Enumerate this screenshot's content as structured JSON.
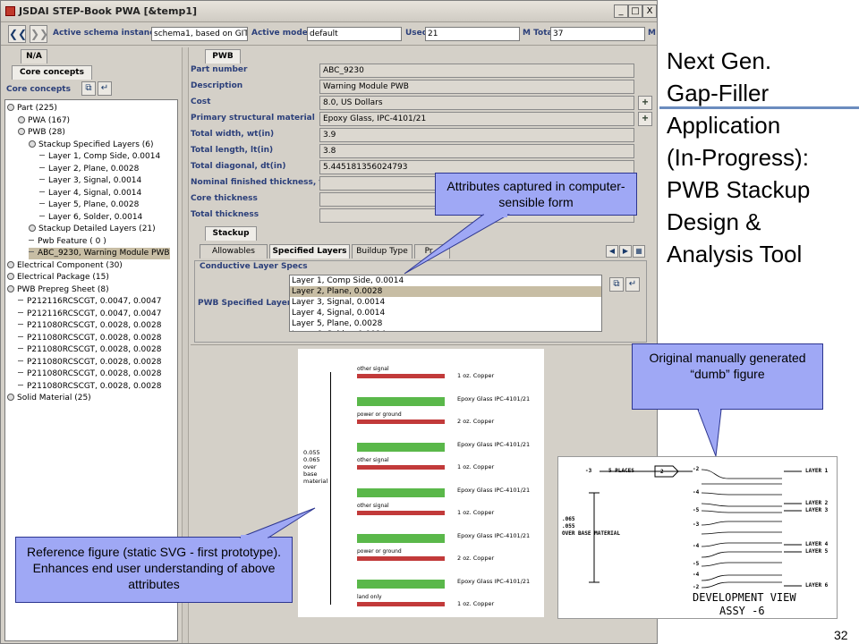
{
  "window": {
    "title": "JSDAI STEP-Book PWA [&temp1]",
    "buttons": {
      "minimize": "_",
      "maximize": "□",
      "close": "X"
    }
  },
  "toolbar": {
    "schema_label": "Active schema instance:",
    "schema_value": "schema1, based on GIT",
    "model_label": "Active model:",
    "model_value": "default",
    "used_label": "Used",
    "used_value": "21",
    "mtotal_label": "M Total",
    "mtotal_value": "37",
    "end_label": "M"
  },
  "left_panel": {
    "tab_label": "N/A",
    "subtab_label": "Core concepts",
    "title": "Core concepts",
    "tree": [
      {
        "label": "Part (225)",
        "level": 0,
        "type": "node"
      },
      {
        "label": "PWA (167)",
        "level": 1,
        "type": "node"
      },
      {
        "label": "PWB (28)",
        "level": 1,
        "type": "node"
      },
      {
        "label": "Stackup Specified Layers (6)",
        "level": 2,
        "type": "node"
      },
      {
        "label": "Layer 1, Comp Side, 0.0014",
        "level": 3,
        "type": "leaf"
      },
      {
        "label": "Layer 2, Plane, 0.0028",
        "level": 3,
        "type": "leaf"
      },
      {
        "label": "Layer 3, Signal, 0.0014",
        "level": 3,
        "type": "leaf"
      },
      {
        "label": "Layer 4, Signal, 0.0014",
        "level": 3,
        "type": "leaf"
      },
      {
        "label": "Layer 5, Plane, 0.0028",
        "level": 3,
        "type": "leaf"
      },
      {
        "label": "Layer 6, Solder, 0.0014",
        "level": 3,
        "type": "leaf"
      },
      {
        "label": "Stackup Detailed Layers (21)",
        "level": 2,
        "type": "node"
      },
      {
        "label": "Pwb Feature ( 0 )",
        "level": 2,
        "type": "leaf"
      },
      {
        "label": "ABC_9230, Warning Module PWB",
        "level": 2,
        "type": "leaf",
        "selected": true
      },
      {
        "label": "Electrical Component (30)",
        "level": 0,
        "type": "node"
      },
      {
        "label": "Electrical Package (15)",
        "level": 0,
        "type": "node"
      },
      {
        "label": "PWB Prepreg Sheet (8)",
        "level": 0,
        "type": "node"
      },
      {
        "label": "P212116RCSCGT, 0.0047, 0.0047",
        "level": 1,
        "type": "leaf"
      },
      {
        "label": "P212116RCSCGT, 0.0047, 0.0047",
        "level": 1,
        "type": "leaf"
      },
      {
        "label": "P211080RCSCGT, 0.0028, 0.0028",
        "level": 1,
        "type": "leaf"
      },
      {
        "label": "P211080RCSCGT, 0.0028, 0.0028",
        "level": 1,
        "type": "leaf"
      },
      {
        "label": "P211080RCSCGT, 0.0028, 0.0028",
        "level": 1,
        "type": "leaf"
      },
      {
        "label": "P211080RCSCGT, 0.0028, 0.0028",
        "level": 1,
        "type": "leaf"
      },
      {
        "label": "P211080RCSCGT, 0.0028, 0.0028",
        "level": 1,
        "type": "leaf"
      },
      {
        "label": "P211080RCSCGT, 0.0028, 0.0028",
        "level": 1,
        "type": "leaf"
      },
      {
        "label": "Solid Material (25)",
        "level": 0,
        "type": "node"
      }
    ]
  },
  "right_panel": {
    "tab_label": "PWB",
    "properties": [
      {
        "label": "Part number",
        "value": "ABC_9230",
        "plus": false
      },
      {
        "label": "Description",
        "value": "Warning Module PWB",
        "plus": false
      },
      {
        "label": "Cost",
        "value": "8.0, US Dollars",
        "plus": true
      },
      {
        "label": "Primary structural material",
        "value": "Epoxy Glass, IPC-4101/21",
        "plus": true
      },
      {
        "label": "Total width, wt(in)",
        "value": "3.9",
        "plus": false
      },
      {
        "label": "Total length, lt(in)",
        "value": "3.8",
        "plus": false
      },
      {
        "label": "Total diagonal, dt(in)",
        "value": "5.445181356024793",
        "plus": false
      },
      {
        "label": "Nominal finished thickness, t(in)",
        "value": "",
        "plus": false
      },
      {
        "label": "Core thickness",
        "value": "",
        "plus": false
      },
      {
        "label": "Total thickness",
        "value": "",
        "plus": false
      }
    ],
    "stackup_tab": "Stackup",
    "subtabs": [
      "Allowables",
      "Specified Layers",
      "Buildup Type",
      "Pr..."
    ],
    "group_title": "Conductive Layer Specs",
    "list_label": "PWB Specified Layers",
    "list_items": [
      {
        "label": "Layer 1, Comp Side, 0.0014"
      },
      {
        "label": "Layer 2, Plane, 0.0028",
        "selected": true
      },
      {
        "label": "Layer 3, Signal, 0.0014"
      },
      {
        "label": "Layer 4, Signal, 0.0014"
      },
      {
        "label": "Layer 5, Plane, 0.0028"
      },
      {
        "label": "Layer 6, Solder, 0.0014"
      }
    ]
  },
  "reference_figure": {
    "dimension_text": [
      "0.055",
      "0.065",
      "over",
      "base",
      "material"
    ],
    "layers": [
      {
        "name": "other signal",
        "material": "1 oz. Copper",
        "kind": "copper"
      },
      {
        "name": "",
        "material": "Epoxy Glass IPC-4101/21",
        "kind": "epoxy"
      },
      {
        "name": "power or ground",
        "material": "2 oz. Copper",
        "kind": "copper"
      },
      {
        "name": "",
        "material": "Epoxy Glass IPC-4101/21",
        "kind": "epoxy"
      },
      {
        "name": "other signal",
        "material": "1 oz. Copper",
        "kind": "copper"
      },
      {
        "name": "",
        "material": "Epoxy Glass IPC-4101/21",
        "kind": "epoxy"
      },
      {
        "name": "other signal",
        "material": "1 oz. Copper",
        "kind": "copper"
      },
      {
        "name": "",
        "material": "Epoxy Glass IPC-4101/21",
        "kind": "epoxy"
      },
      {
        "name": "power or ground",
        "material": "2 oz. Copper",
        "kind": "copper"
      },
      {
        "name": "",
        "material": "Epoxy Glass IPC-4101/21",
        "kind": "epoxy"
      },
      {
        "name": "land only",
        "material": "1 oz. Copper",
        "kind": "copper"
      }
    ],
    "colors": {
      "copper": "#c23a3a",
      "epoxy": "#5ab84a"
    }
  },
  "development_figure": {
    "places_label": "5 PLACES",
    "places_box": "2",
    "dimension_label": ".065\n.055\nOVER BASE MATERIAL",
    "layer_labels": [
      "LAYER 1",
      "LAYER 2",
      "LAYER 3",
      "LAYER 4",
      "LAYER 5",
      "LAYER 6"
    ],
    "tick_labels": [
      "-2",
      "-3",
      "-4",
      "-5",
      "-3",
      "-4",
      "-5",
      "-4",
      "-2"
    ],
    "caption_line1": "DEVELOPMENT VIEW",
    "caption_line2": "ASSY -6"
  },
  "slide": {
    "title_lines": [
      "Next Gen.",
      "Gap-Filler",
      "Application",
      "(In-Progress):",
      "PWB Stackup",
      "Design &",
      "Analysis Tool"
    ],
    "page_number": "32",
    "accent_color": "#6b8cbf"
  },
  "callouts": {
    "attributes": "Attributes captured in computer-sensible form",
    "original": "Original manually generated “dumb” figure",
    "reference": "Reference figure (static SVG - first prototype). Enhances end user understanding of above attributes",
    "fill_color": "#9fa8f5"
  }
}
